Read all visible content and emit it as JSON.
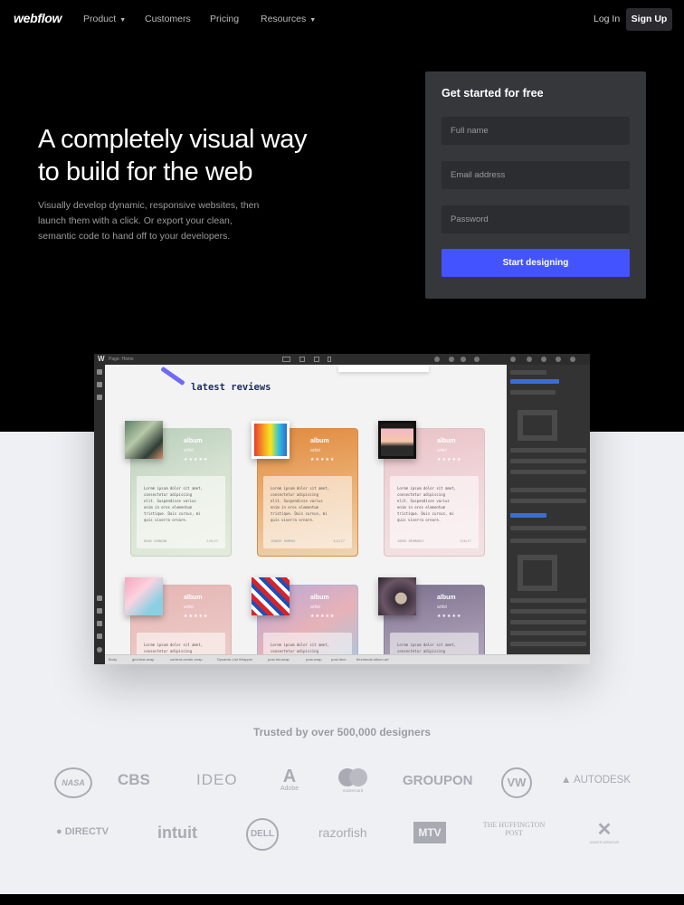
{
  "nav": {
    "logo": "webflow",
    "links": [
      {
        "label": "Product",
        "has_caret": true
      },
      {
        "label": "Customers",
        "has_caret": false
      },
      {
        "label": "Pricing",
        "has_caret": false
      },
      {
        "label": "Resources",
        "has_caret": true
      }
    ],
    "login": "Log In",
    "signup": "Sign Up"
  },
  "hero": {
    "headline_line1": "A completely visual way",
    "headline_line2": "to build for the web",
    "sub_line1": "Visually develop dynamic, responsive websites, then",
    "sub_line2": "launch them with a click. Or export your clean,",
    "sub_line3": "semantic code to hand off to your developers."
  },
  "signup_form": {
    "title": "Get started for free",
    "full_name_placeholder": "Full name",
    "email_placeholder": "Email address",
    "password_placeholder": "Password",
    "submit": "Start designing"
  },
  "designer_preview": {
    "logo": "W",
    "page_label": "Page: Home",
    "section_title": "latest reviews",
    "cards": [
      {
        "album": "album",
        "artist": "artist",
        "stars": "★★★★★",
        "lorem": [
          "Lorem ipsum dolor sit amet,",
          "consectetur adipiscing",
          "elit. Suspendisse varius",
          "enim in eros elementum",
          "tristique. Duis cursus, mi",
          "quis viverra ornare."
        ],
        "author": "DEAN JOHNSON",
        "date": "2/6/17"
      },
      {
        "album": "album",
        "artist": "artist",
        "stars": "★★★★★",
        "lorem": [
          "Lorem ipsum dolor sit amet,",
          "consectetur adipiscing",
          "elit. Suspendisse varius",
          "enim in eros elementum",
          "tristique. Duis cursus, mi",
          "quis viverra ornare."
        ],
        "author": "JENNIE ROMERO",
        "date": "4/4/17"
      },
      {
        "album": "album",
        "artist": "artist",
        "stars": "★★★★★",
        "lorem": [
          "Lorem ipsum dolor sit amet,",
          "consectetur adipiscing",
          "elit. Suspendisse varius",
          "enim in eros elementum",
          "tristique. Duis cursus, mi",
          "quis viverra ornare."
        ],
        "author": "JAMIE BERMUDEZ",
        "date": "3/8/17"
      },
      {
        "album": "album",
        "artist": "artist",
        "stars": "★★★★★",
        "lorem": [
          "Lorem ipsum dolor sit amet,",
          "consectetur adipiscing"
        ],
        "author": "",
        "date": ""
      },
      {
        "album": "album",
        "artist": "artist",
        "stars": "★★★★★",
        "lorem": [
          "Lorem ipsum dolor sit amet,",
          "consectetur adipiscing"
        ],
        "author": "",
        "date": ""
      },
      {
        "album": "album",
        "artist": "artist",
        "stars": "★★★★★",
        "lorem": [
          "Lorem ipsum dolor sit amet,",
          "consectetur adipiscing"
        ],
        "author": "",
        "date": ""
      }
    ],
    "breadcrumbs": [
      "Body",
      "grid-test-wrap",
      "content-center-wrap",
      "Dynamic List Wrapper",
      "post-list-wrap",
      "post-wrap",
      "post-item",
      "thumbnail-album-art"
    ]
  },
  "trusted": {
    "text": "Trusted by over 500,000 designers",
    "logos_row1": [
      "NASA",
      "CBS",
      "IDEO",
      "Adobe",
      "mastercard",
      "GROUPON",
      "VW",
      "AUTODESK"
    ],
    "logos_row2": [
      "DIRECTV",
      "intuit",
      "DELL",
      "razorfish",
      "MTV",
      "THE HUFFINGTON POST",
      "UNDER ARMOUR"
    ]
  },
  "colors": {
    "accent": "#4353ff",
    "hero_bg": "#000000",
    "form_bg": "#36373b",
    "page_bg": "#eef0f4"
  }
}
